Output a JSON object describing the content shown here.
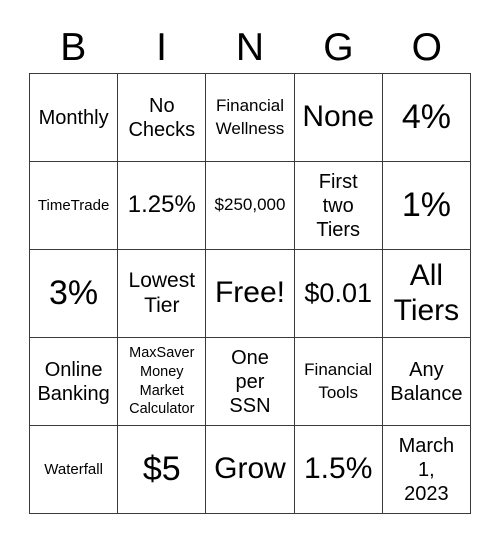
{
  "header": {
    "letters": [
      "B",
      "I",
      "N",
      "G",
      "O"
    ]
  },
  "board": {
    "rows": [
      [
        "Monthly",
        "No\nChecks",
        "Financial\nWellness",
        "None",
        "4%"
      ],
      [
        "TimeTrade",
        "1.25%",
        "$250,000",
        "First\ntwo\nTiers",
        "1%"
      ],
      [
        "3%",
        "Lowest\nTier",
        "Free!",
        "$0.01",
        "All\nTiers"
      ],
      [
        "Online\nBanking",
        "MaxSaver\nMoney\nMarket\nCalculator",
        "One\nper\nSSN",
        "Financial\nTools",
        "Any\nBalance"
      ],
      [
        "Waterfall",
        "$5",
        "Grow",
        "1.5%",
        "March\n1,\n2023"
      ]
    ],
    "free_space": "Free!"
  },
  "colors": {
    "grid_line": "#3a3a3a",
    "text": "#000000",
    "background": "#ffffff"
  }
}
